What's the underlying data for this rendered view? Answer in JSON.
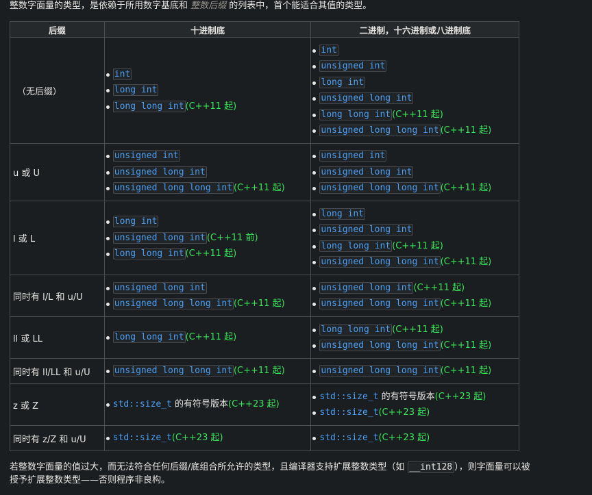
{
  "intro": {
    "before": "整数字面量的类型，是依赖于所用数字基底和 ",
    "em": "整数后缀",
    "after": " 的列表中，首个能适合其值的类型。"
  },
  "table": {
    "headers": [
      "后缀",
      "十进制底",
      "二进制，十六进制或八进制底"
    ],
    "rows": [
      {
        "suffix": "（无后缀）",
        "decimal": [
          {
            "type": "int",
            "note": ""
          },
          {
            "type": "long int",
            "note": ""
          },
          {
            "type": "long long int",
            "note": "(C++11 起)"
          }
        ],
        "other": [
          {
            "type": "int",
            "note": ""
          },
          {
            "type": "unsigned int",
            "note": ""
          },
          {
            "type": "long int",
            "note": ""
          },
          {
            "type": "unsigned long int",
            "note": ""
          },
          {
            "type": "long long int",
            "note": "(C++11 起)"
          },
          {
            "type": "unsigned long long int",
            "note": "(C++11 起)"
          }
        ]
      },
      {
        "suffix": "u 或 U",
        "decimal": [
          {
            "type": "unsigned int",
            "note": ""
          },
          {
            "type": "unsigned long int",
            "note": ""
          },
          {
            "type": "unsigned long long int",
            "note": "(C++11 起)"
          }
        ],
        "other": [
          {
            "type": "unsigned int",
            "note": ""
          },
          {
            "type": "unsigned long int",
            "note": ""
          },
          {
            "type": "unsigned long long int",
            "note": "(C++11 起)"
          }
        ]
      },
      {
        "suffix": "l 或 L",
        "decimal": [
          {
            "type": "long int",
            "note": ""
          },
          {
            "type": "unsigned long int",
            "note": "(C++11 前)"
          },
          {
            "type": "long long int",
            "note": "(C++11 起)"
          }
        ],
        "other": [
          {
            "type": "long int",
            "note": ""
          },
          {
            "type": "unsigned long int",
            "note": ""
          },
          {
            "type": "long long int",
            "note": "(C++11 起)"
          },
          {
            "type": "unsigned long long int",
            "note": "(C++11 起)"
          }
        ]
      },
      {
        "suffix": "同时有 l/L 和 u/U",
        "decimal": [
          {
            "type": "unsigned long int",
            "note": ""
          },
          {
            "type": "unsigned long long int",
            "note": "(C++11 起)"
          }
        ],
        "other": [
          {
            "type": "unsigned long int",
            "note": "(C++11 起)"
          },
          {
            "type": "unsigned long long int",
            "note": "(C++11 起)"
          }
        ]
      },
      {
        "suffix": "ll 或 LL",
        "decimal": [
          {
            "type": "long long int",
            "note": "(C++11 起)"
          }
        ],
        "other": [
          {
            "type": "long long int",
            "note": "(C++11 起)"
          },
          {
            "type": "unsigned long long int",
            "note": "(C++11 起)"
          }
        ]
      },
      {
        "suffix": "同时有 ll/LL 和 u/U",
        "decimal": [
          {
            "type": "unsigned long long int",
            "note": "(C++11 起)"
          }
        ],
        "other": [
          {
            "type": "unsigned long long int",
            "note": "(C++11 起)"
          }
        ]
      },
      {
        "suffix": "z 或 Z",
        "decimal": [
          {
            "plain_type": "std::size_t",
            "text": " 的有符号版本",
            "note": "(C++23 起)"
          }
        ],
        "other": [
          {
            "plain_type": "std::size_t",
            "text": " 的有符号版本",
            "note": "(C++23 起)"
          },
          {
            "plain_type": "std::size_t",
            "text": "",
            "note": "(C++23 起)"
          }
        ]
      },
      {
        "suffix": "同时有 z/Z 和 u/U",
        "decimal": [
          {
            "plain_type": "std::size_t",
            "text": "",
            "note": "(C++23 起)"
          }
        ],
        "other": [
          {
            "plain_type": "std::size_t",
            "text": "",
            "note": "(C++23 起)"
          }
        ]
      }
    ]
  },
  "outro": {
    "line1_before": "若整数字面量的值过大，而无法符合任何后缀/底组合所允许的类型，且编译器支持扩展整数类型（如 ",
    "code": "__int128",
    "line1_after": "），则字面量可以被",
    "line2": "授予扩展整数类型——否则程序非良构。"
  },
  "colors": {
    "background": "#1b1e20",
    "code": "#4a9ff5",
    "since": "#39e55a",
    "border": "#4b4f53"
  }
}
